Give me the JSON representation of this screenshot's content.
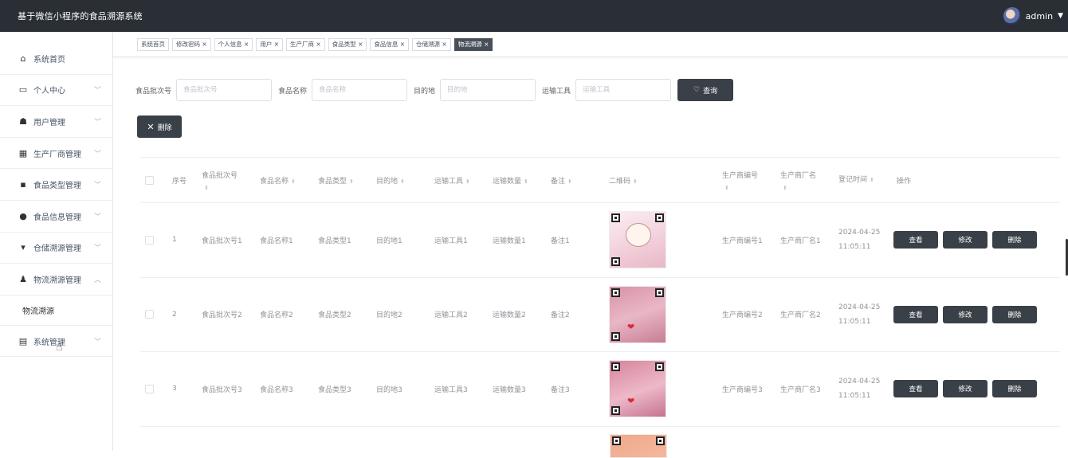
{
  "header": {
    "title": "基于微信小程序的食品溯源系统",
    "username": "admin"
  },
  "sidebar": {
    "items": [
      {
        "label": "系统首页",
        "icon": "home-icon",
        "expandable": false
      },
      {
        "label": "个人中心",
        "icon": "card-icon",
        "expandable": true
      },
      {
        "label": "用户管理",
        "icon": "user-group-icon",
        "expandable": true
      },
      {
        "label": "生产厂商管理",
        "icon": "grid-icon",
        "expandable": true
      },
      {
        "label": "食品类型管理",
        "icon": "chat-icon",
        "expandable": true
      },
      {
        "label": "食品信息管理",
        "icon": "pin-icon",
        "expandable": true
      },
      {
        "label": "仓储溯源管理",
        "icon": "cup-icon",
        "expandable": true
      },
      {
        "label": "物流溯源管理",
        "icon": "person-icon",
        "expandable": true,
        "expanded": true
      },
      {
        "label": "系统管理",
        "icon": "clipboard-icon",
        "expandable": true
      }
    ],
    "subitem": "物流溯源"
  },
  "tabs": [
    {
      "label": "系统首页",
      "closable": false
    },
    {
      "label": "修改密码",
      "closable": true
    },
    {
      "label": "个人信息",
      "closable": true
    },
    {
      "label": "用户",
      "closable": true
    },
    {
      "label": "生产厂商",
      "closable": true
    },
    {
      "label": "食品类型",
      "closable": true
    },
    {
      "label": "食品信息",
      "closable": true
    },
    {
      "label": "仓储溯源",
      "closable": true
    },
    {
      "label": "物流溯源",
      "closable": true,
      "active": true
    }
  ],
  "search": {
    "batch_label": "食品批次号",
    "batch_placeholder": "食品批次号",
    "name_label": "食品名称",
    "name_placeholder": "食品名称",
    "dest_label": "目的地",
    "dest_placeholder": "目的地",
    "tool_label": "运输工具",
    "tool_placeholder": "运输工具",
    "query_label": "查询"
  },
  "actions": {
    "delete_label": "删除"
  },
  "table": {
    "headers": {
      "index": "序号",
      "batch": "食品批次号",
      "name": "食品名称",
      "type": "食品类型",
      "dest": "目的地",
      "tool": "运输工具",
      "qty": "运输数量",
      "note": "备注",
      "qr": "二维码",
      "mcode": "生产商编号",
      "mname": "生产商厂名",
      "time": "登记时间",
      "ops": "操作"
    },
    "rows": [
      {
        "index": "1",
        "batch": "食品批次号1",
        "name": "食品名称1",
        "type": "食品类型1",
        "dest": "目的地1",
        "tool": "运输工具1",
        "qty": "运输数量1",
        "note": "备注1",
        "mcode": "生产商编号1",
        "mname": "生产商厂名1",
        "date": "2024-04-25",
        "time": "11:05:11"
      },
      {
        "index": "2",
        "batch": "食品批次号2",
        "name": "食品名称2",
        "type": "食品类型2",
        "dest": "目的地2",
        "tool": "运输工具2",
        "qty": "运输数量2",
        "note": "备注2",
        "mcode": "生产商编号2",
        "mname": "生产商厂名2",
        "date": "2024-04-25",
        "time": "11:05:11"
      },
      {
        "index": "3",
        "batch": "食品批次号3",
        "name": "食品名称3",
        "type": "食品类型3",
        "dest": "目的地3",
        "tool": "运输工具3",
        "qty": "运输数量3",
        "note": "备注3",
        "mcode": "生产商编号3",
        "mname": "生产商厂名3",
        "date": "2024-04-25",
        "time": "11:05:11"
      }
    ],
    "row_buttons": {
      "view": "查看",
      "edit": "修改",
      "delete": "删除"
    }
  }
}
